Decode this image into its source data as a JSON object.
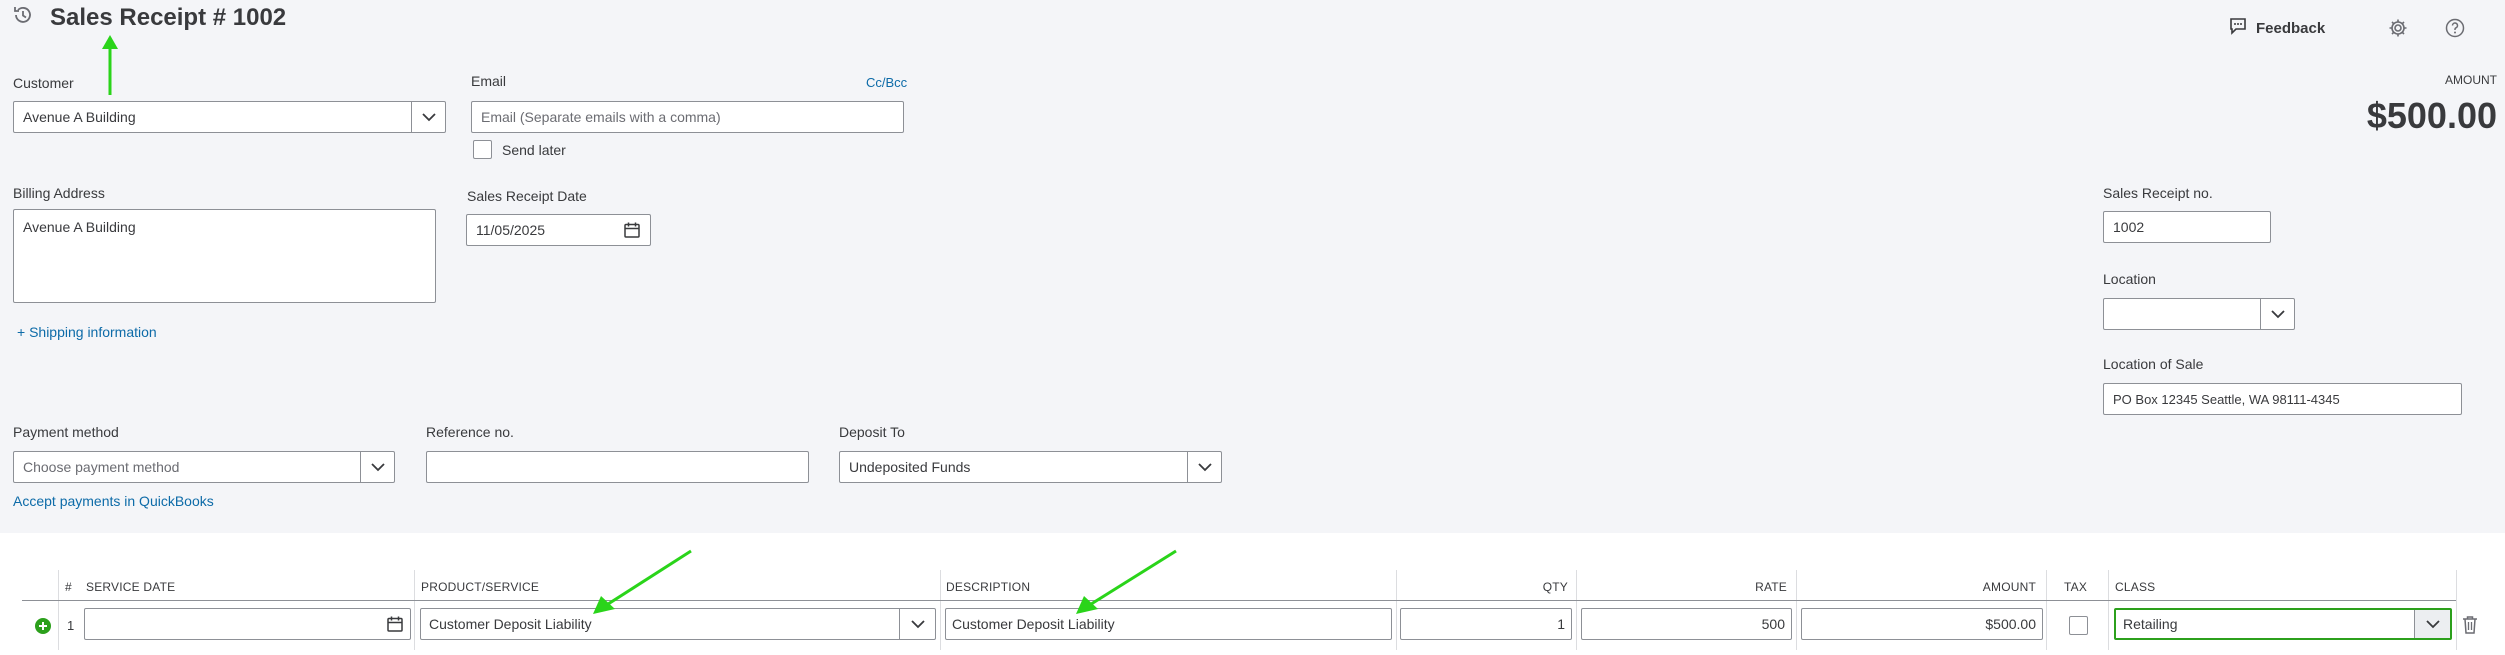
{
  "header": {
    "title": "Sales Receipt # 1002",
    "feedback_label": "Feedback",
    "amount_label": "AMOUNT",
    "amount_value": "$500.00"
  },
  "customer": {
    "label": "Customer",
    "value": "Avenue A Building"
  },
  "email": {
    "label": "Email",
    "ccbcc_label": "Cc/Bcc",
    "placeholder": "Email (Separate emails with a comma)",
    "send_later_label": "Send later"
  },
  "billing": {
    "label": "Billing Address",
    "value": "Avenue A Building",
    "shipping_link": "+ Shipping information"
  },
  "receipt_date": {
    "label": "Sales Receipt Date",
    "value": "11/05/2025"
  },
  "right_panel": {
    "receipt_no_label": "Sales Receipt no.",
    "receipt_no_value": "1002",
    "location_label": "Location",
    "location_value": "",
    "location_of_sale_label": "Location of Sale",
    "location_of_sale_value": "PO Box 12345 Seattle, WA 98111-4345"
  },
  "payment": {
    "method_label": "Payment method",
    "method_placeholder": "Choose payment method",
    "reference_label": "Reference no.",
    "reference_value": "",
    "deposit_label": "Deposit To",
    "deposit_value": "Undeposited Funds",
    "accept_link": "Accept payments in QuickBooks"
  },
  "table": {
    "headers": {
      "num": "#",
      "service_date": "SERVICE DATE",
      "product": "PRODUCT/SERVICE",
      "description": "DESCRIPTION",
      "qty": "QTY",
      "rate": "RATE",
      "amount": "AMOUNT",
      "tax": "TAX",
      "class": "CLASS"
    },
    "rows": [
      {
        "num": "1",
        "service_date": "",
        "product": "Customer Deposit Liability",
        "description": "Customer Deposit Liability",
        "qty": "1",
        "rate": "500",
        "amount": "$500.00",
        "class": "Retailing"
      }
    ]
  },
  "colors": {
    "accent_link": "#0d6ba8",
    "annotation_arrow": "#2ad41a",
    "add_green": "#2ca01c",
    "class_focus": "#2ca01c"
  },
  "icons": [
    "history-icon",
    "feedback-icon",
    "gear-icon",
    "help-icon",
    "chevron-down-icon",
    "calendar-icon",
    "add-line-icon",
    "trash-icon"
  ]
}
